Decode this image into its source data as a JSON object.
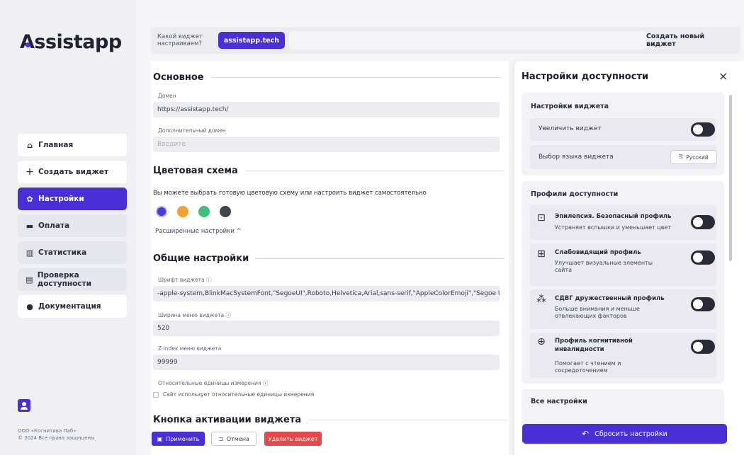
{
  "app": {
    "logo": "Assistapp"
  },
  "sidebar": {
    "items": [
      {
        "label": "Главная",
        "icon": "⌂"
      },
      {
        "label": "Создать виджет",
        "icon": "+"
      },
      {
        "label": "Настройки",
        "icon": "✿"
      },
      {
        "label": "Оплата",
        "icon": "▬"
      },
      {
        "label": "Статистика",
        "icon": "▥"
      },
      {
        "label": "Проверка доступности",
        "icon": "▤"
      },
      {
        "label": "Документация",
        "icon": "●"
      }
    ],
    "company_line1": "ООО «Когнитива Лаб»",
    "company_line2": "© 2024 Все права защищены"
  },
  "topbar": {
    "question": "Какой виджет настраиваем?",
    "domain": "assistapp.tech",
    "create_label": "Создать новый виджет"
  },
  "main": {
    "basic": {
      "title": "Основное",
      "domain_label": "Домен",
      "domain_value": "https://assistapp.tech/",
      "extra_domain_label": "Дополнительный домен",
      "extra_domain_placeholder": "Введите"
    },
    "colors": {
      "title": "Цветовая схема",
      "description": "Вы можете выбрать готовую цветовую схему или настроить виджет самостоятельно",
      "swatches": [
        "#4a3ad8",
        "#f0a030",
        "#3ec07a",
        "#40444e"
      ],
      "advanced_label": "Расширенные настройки ^"
    },
    "general": {
      "title": "Общие настройки",
      "font_label": "Шрифт виджета ⓘ",
      "font_value": "-apple-system,BlinkMacSystemFont,\"SegoeUI\",Roboto,Helvetica,Arial,sans-serif,\"AppleColorEmoji\",\"Segoe UI E",
      "width_label": "Ширина меню виджета ⓘ",
      "width_value": "520",
      "zindex_label": "Z-index меню виджета",
      "zindex_value": "99999",
      "units_label": "Относительные единицы измерения ⓘ",
      "units_checkbox": "Сайт использует относительные единицы измерения"
    },
    "activation": {
      "title": "Кнопка активации виджета"
    },
    "buttons": {
      "apply": "Применить",
      "cancel": "Отмена",
      "delete": "Удалить виджет"
    }
  },
  "panel": {
    "title": "Настройки доступности",
    "close": "×",
    "widget_settings": {
      "title": "Настройки виджета",
      "enlarge": "Увеличить виджет",
      "lang_label": "Выбор языка виджета",
      "lang_value": "Русский"
    },
    "profiles": {
      "title": "Профили доступности",
      "items": [
        {
          "icon": "⊡",
          "title": "Эпилепсия. Безопасный профиль",
          "desc": "Устраняет вспышки и уменьшает цвет"
        },
        {
          "icon": "⊞",
          "title": "Слабовидящий профиль",
          "desc": "Улучшает визуальные элементы сайта"
        },
        {
          "icon": "⁂",
          "title": "СДВГ дружественный профиль",
          "desc": "Больше внимания и меньше отвлекающих факторов"
        },
        {
          "icon": "⊕",
          "title": "Профиль когнитивной инвалидности",
          "desc": "Помогает с чтением и сосредоточением"
        }
      ]
    },
    "all_settings": {
      "title": "Все настройки"
    },
    "reset": {
      "label": "Сбросить настройки"
    }
  }
}
